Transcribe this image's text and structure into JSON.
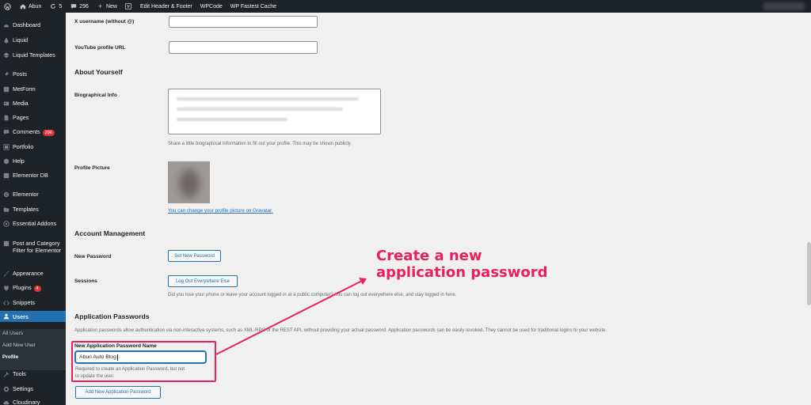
{
  "adminbar": {
    "site_name": "Abun",
    "updates_count": "5",
    "comments_count": "296",
    "new_label": "New",
    "links": [
      "Edit Header & Footer",
      "WPCode",
      "WP Fastest Cache"
    ]
  },
  "sidebar": {
    "items": [
      {
        "label": "Dashboard",
        "icon": "dashboard-icon"
      },
      {
        "label": "Liquid",
        "icon": "drop-icon"
      },
      {
        "label": "Liquid Templates",
        "icon": "layers-icon"
      },
      {
        "label": "Posts",
        "icon": "pin-icon"
      },
      {
        "label": "MetForm",
        "icon": "form-icon"
      },
      {
        "label": "Media",
        "icon": "media-icon"
      },
      {
        "label": "Pages",
        "icon": "page-icon"
      },
      {
        "label": "Comments",
        "icon": "comment-icon",
        "badge": "296"
      },
      {
        "label": "Portfolio",
        "icon": "portfolio-icon"
      },
      {
        "label": "Help",
        "icon": "help-icon"
      },
      {
        "label": "Elementor DB",
        "icon": "database-icon"
      },
      {
        "label": "Elementor",
        "icon": "elementor-icon"
      },
      {
        "label": "Templates",
        "icon": "folder-icon"
      },
      {
        "label": "Essential Addons",
        "icon": "addons-icon"
      },
      {
        "label": "Post and Category Filter for Elementor",
        "icon": "filter-icon"
      },
      {
        "label": "Appearance",
        "icon": "brush-icon"
      },
      {
        "label": "Plugins",
        "icon": "plugin-icon",
        "badge": "4"
      },
      {
        "label": "Snippets",
        "icon": "code-icon"
      },
      {
        "label": "Users",
        "icon": "users-icon"
      },
      {
        "label": "Tools",
        "icon": "wrench-icon"
      },
      {
        "label": "Settings",
        "icon": "settings-icon"
      },
      {
        "label": "Cloudinary",
        "icon": "cloud-icon"
      }
    ],
    "submenu": [
      "All Users",
      "Add New User",
      "Profile"
    ]
  },
  "form": {
    "x_username_label": "X username (without @)",
    "youtube_label": "YouTube profile URL",
    "about_heading": "About Yourself",
    "bio_label": "Biographical Info",
    "bio_desc": "Share a little biographical information to fill out your profile. This may be shown publicly.",
    "picture_label": "Profile Picture",
    "gravatar_link": "You can change your profile picture on Gravatar.",
    "account_heading": "Account Management",
    "new_password_label": "New Password",
    "set_password_button": "Set New Password",
    "sessions_label": "Sessions",
    "logout_button": "Log Out Everywhere Else",
    "sessions_desc": "Did you lose your phone or leave your account logged in at a public computer? You can log out everywhere else, and stay logged in here.",
    "app_heading": "Application Passwords",
    "app_desc": "Application passwords allow authentication via non-interactive systems, such as XML-RPC or the REST API, without providing your actual password. Application passwords can be easily revoked. They cannot be used for traditional logins to your website.",
    "new_app_label": "New Application Password Name",
    "new_app_value": "Abun Auto Blog",
    "new_app_help_1": "Required to create an Application Password, but not",
    "new_app_help_2": "to update the user.",
    "add_app_button": "Add New Application Password"
  },
  "annotation": {
    "line1": "Create a new",
    "line2": "application password",
    "color": "#e8205b"
  }
}
